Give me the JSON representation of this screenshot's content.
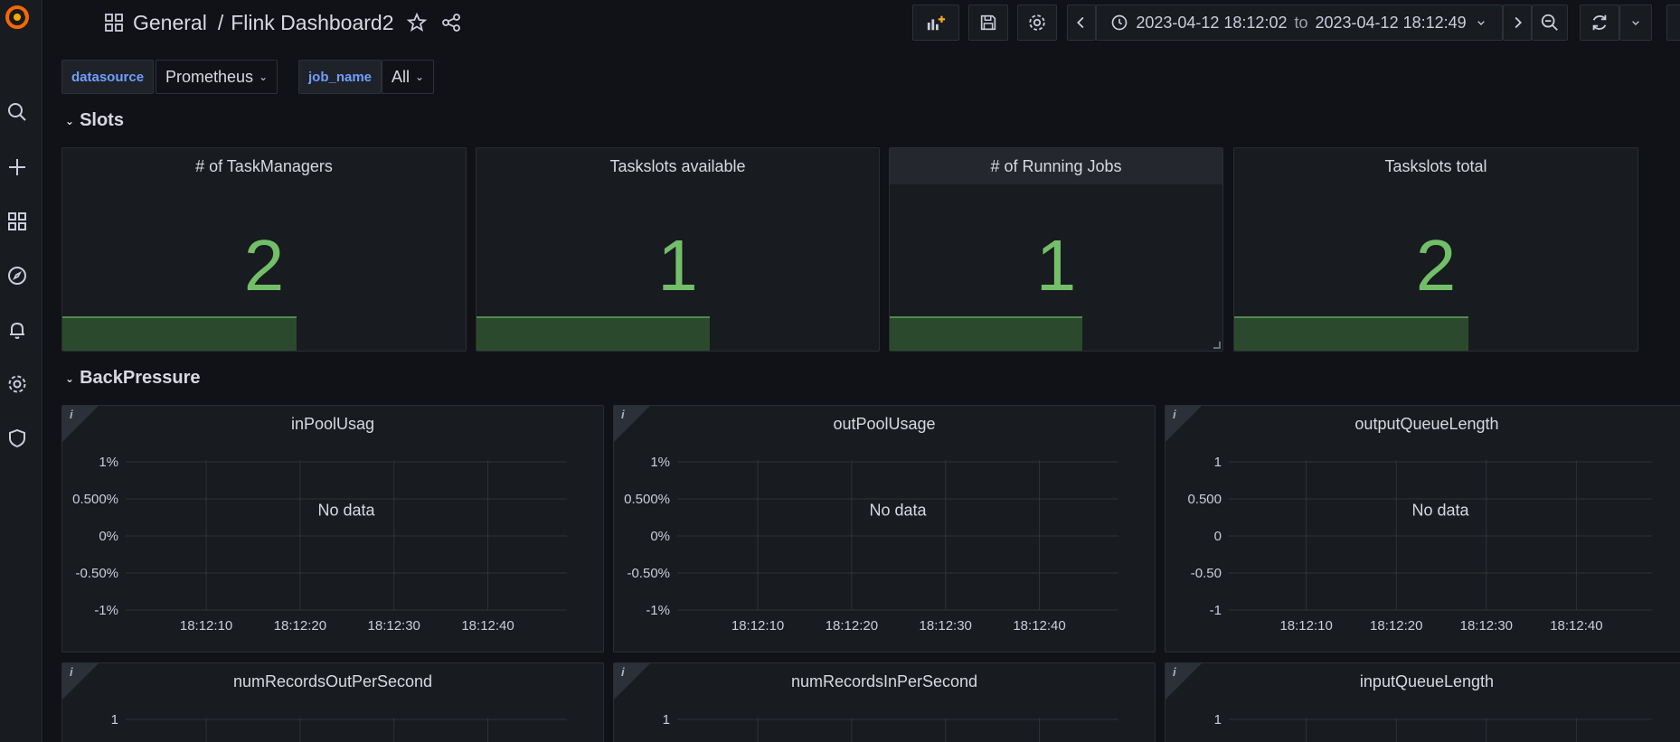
{
  "breadcrumb": {
    "folder": "General",
    "separator": "/",
    "dashboard": "Flink Dashboard2"
  },
  "time_range": {
    "from": "2023-04-12 18:12:02",
    "to_word": "to",
    "to": "2023-04-12 18:12:49"
  },
  "variables": [
    {
      "label": "datasource",
      "value": "Prometheus"
    },
    {
      "label": "job_name",
      "value": "All"
    }
  ],
  "rows": [
    {
      "title": "Slots"
    },
    {
      "title": "BackPressure"
    }
  ],
  "stats": [
    {
      "title": "# of TaskManagers",
      "value": "2",
      "spark_fill": 0.58
    },
    {
      "title": "Taskslots available",
      "value": "1",
      "spark_fill": 0.58
    },
    {
      "title": "# of Running Jobs",
      "value": "1",
      "spark_fill": 0.58
    },
    {
      "title": "Taskslots total",
      "value": "2",
      "spark_fill": 0.58
    }
  ],
  "graphs": [
    {
      "title": "inPoolUsag",
      "no_data": "No data",
      "y_ticks": [
        "1%",
        "0.500%",
        "0%",
        "-0.50%",
        "-1%"
      ],
      "x_ticks": [
        "18:12:10",
        "18:12:20",
        "18:12:30",
        "18:12:40"
      ]
    },
    {
      "title": "outPoolUsage",
      "no_data": "No data",
      "y_ticks": [
        "1%",
        "0.500%",
        "0%",
        "-0.50%",
        "-1%"
      ],
      "x_ticks": [
        "18:12:10",
        "18:12:20",
        "18:12:30",
        "18:12:40"
      ]
    },
    {
      "title": "outputQueueLength",
      "no_data": "No data",
      "y_ticks": [
        "1",
        "0.500",
        "0",
        "-0.50",
        "-1"
      ],
      "x_ticks": [
        "18:12:10",
        "18:12:20",
        "18:12:30",
        "18:12:40"
      ]
    },
    {
      "title": "numRecordsOutPerSecond",
      "no_data": "",
      "y_ticks": [
        "1"
      ],
      "x_ticks": []
    },
    {
      "title": "numRecordsInPerSecond",
      "no_data": "",
      "y_ticks": [
        "1"
      ],
      "x_ticks": []
    },
    {
      "title": "inputQueueLength",
      "no_data": "",
      "y_ticks": [
        "1"
      ],
      "x_ticks": []
    }
  ],
  "info_glyph": "i",
  "colors": {
    "stat_value": "#73bf69",
    "spark_fill": "#2b4a2d",
    "spark_line": "#4f8a4d",
    "var_label": "#6e9fff"
  }
}
